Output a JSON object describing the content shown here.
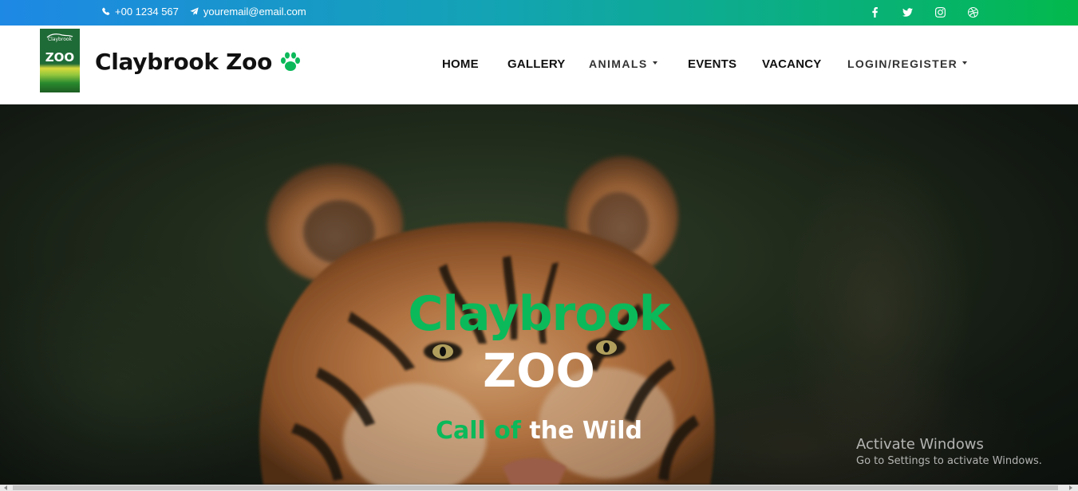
{
  "topbar": {
    "phone": "+00 1234 567",
    "email": "youremail@email.com",
    "social": [
      "facebook-icon",
      "twitter-icon",
      "instagram-icon",
      "dribbble-icon"
    ]
  },
  "header": {
    "logo": {
      "small": "Claybrook",
      "big": "ZOO"
    },
    "brand": "Claybrook Zoo",
    "brand_icon": "paw-icon",
    "nav": [
      {
        "label": "HOME"
      },
      {
        "label": "GALLERY"
      },
      {
        "label": "ANIMALS",
        "dropdown": true
      },
      {
        "label": "EVENTS"
      },
      {
        "label": "VACANCY"
      },
      {
        "label": "LOGIN/REGISTER",
        "dropdown": true
      }
    ]
  },
  "hero": {
    "title_line1": "Claybrook",
    "title_line2": "ZOO",
    "tagline_green": "Call of",
    "tagline_white": "the Wild"
  },
  "watermark": {
    "line1": "Activate Windows",
    "line2": "Go to Settings to activate Windows."
  },
  "colors": {
    "accent_green": "#0bb95a",
    "topbar_start": "#1e88e5",
    "topbar_end": "#03b94c"
  }
}
